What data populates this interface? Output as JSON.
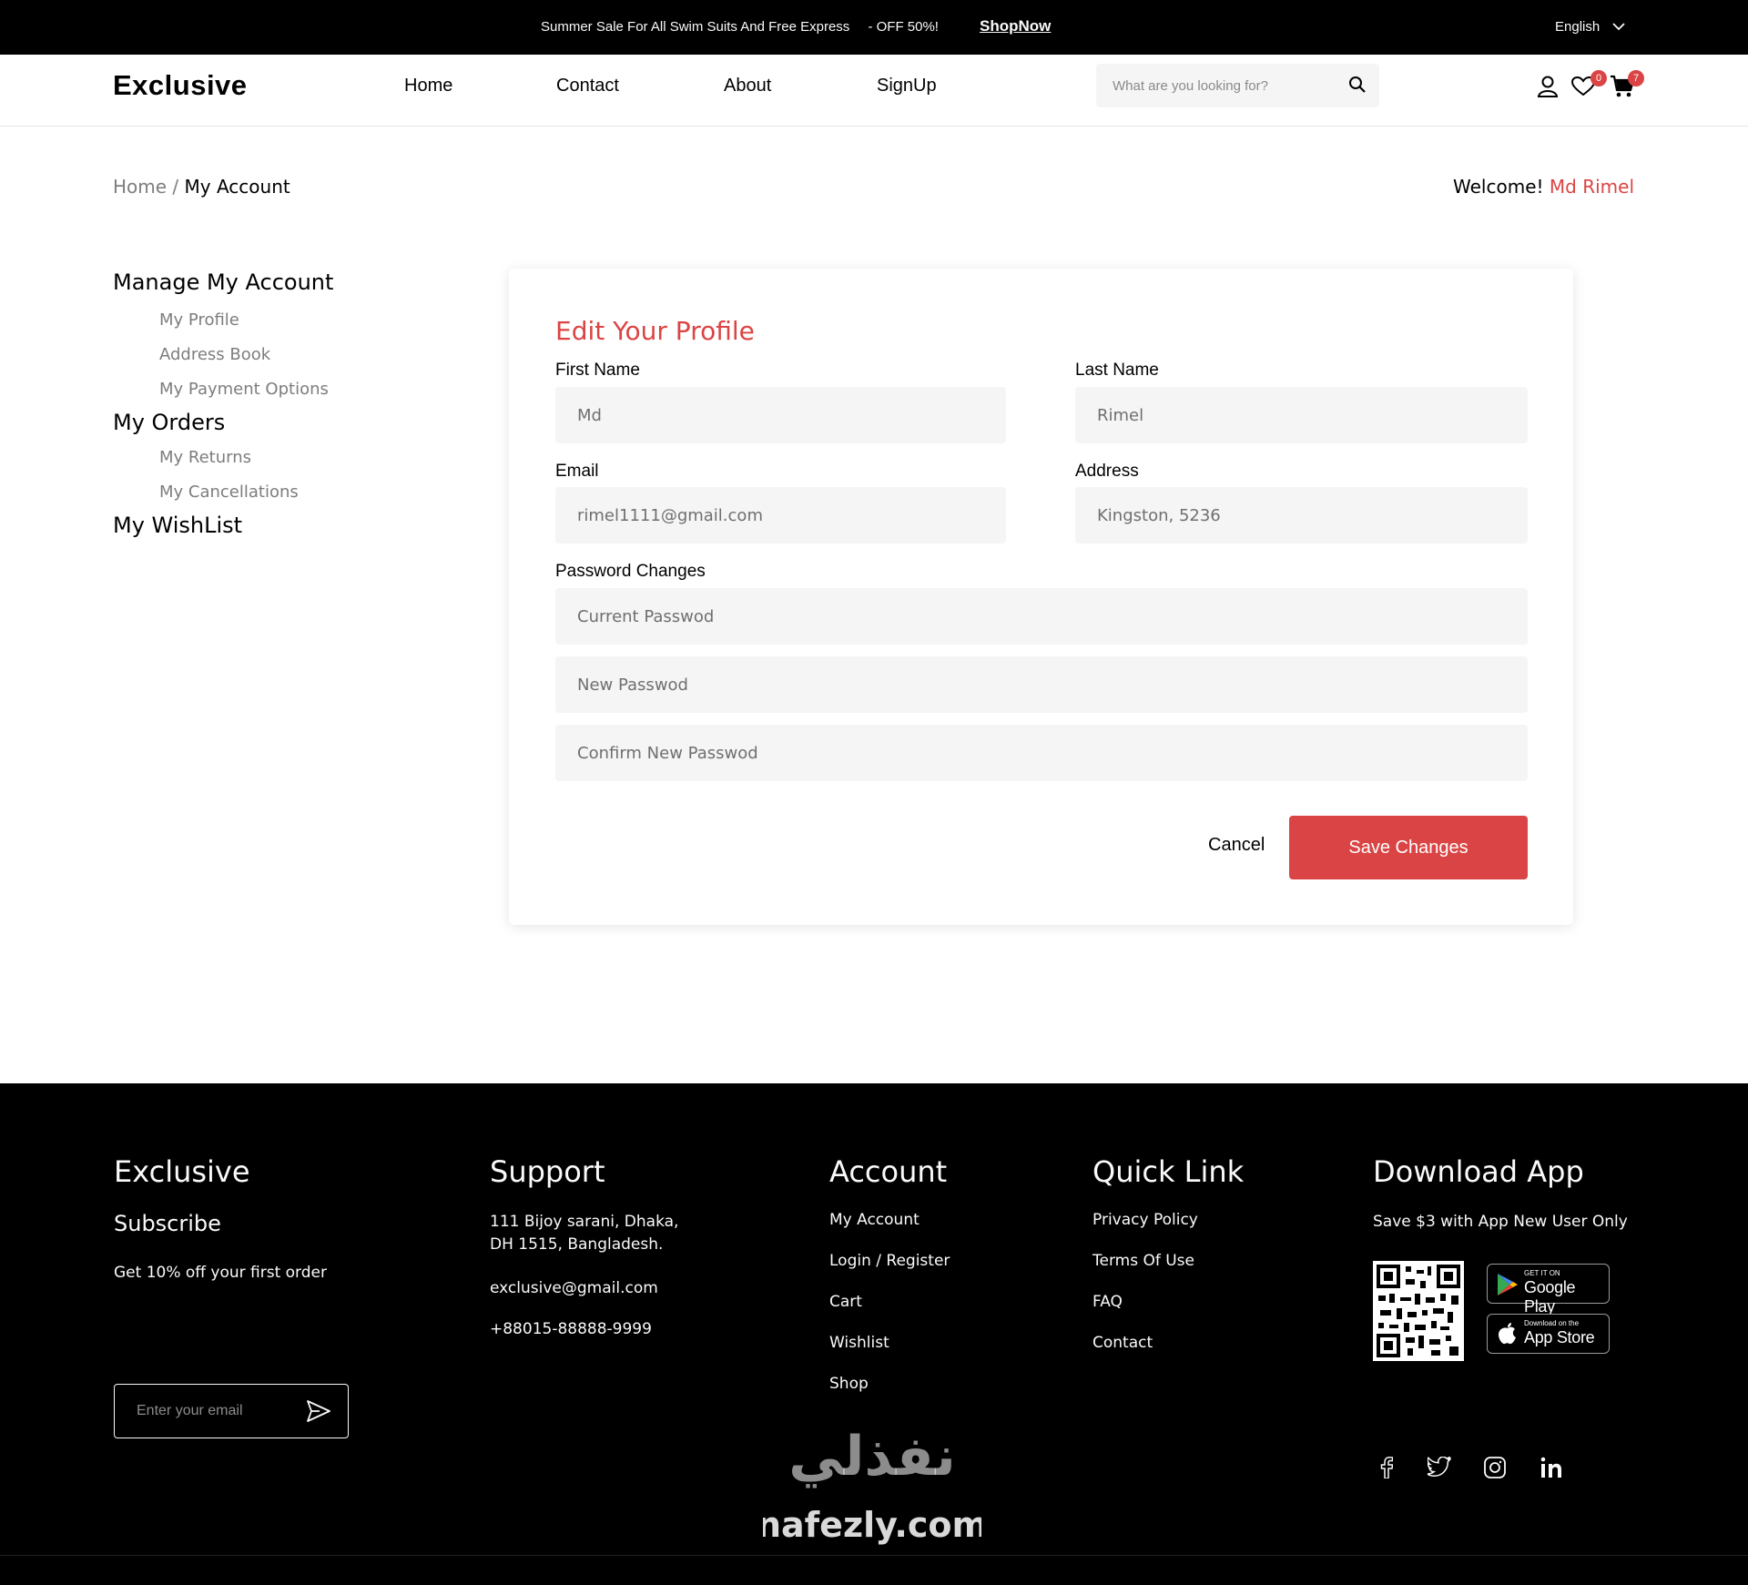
{
  "topbar": {
    "promo_text": "Summer Sale For All Swim Suits And Free Express",
    "discount_text": "- OFF 50%!",
    "shop_now": "ShopNow",
    "language": "English"
  },
  "header": {
    "logo": "Exclusive",
    "nav": [
      "Home",
      "Contact",
      "About",
      "SignUp"
    ],
    "search_placeholder": "What are you looking for?",
    "wishlist_count": "0",
    "cart_count": "7"
  },
  "breadcrumb": {
    "home": "Home",
    "separator": "/",
    "current": "My Account"
  },
  "welcome": {
    "prefix": "Welcome!",
    "name": "Md Rimel"
  },
  "sidebar": {
    "manage_account": "Manage My Account",
    "account_items": [
      "My Profile",
      "Address Book",
      "My Payment Options"
    ],
    "my_orders": "My Orders",
    "order_items": [
      "My Returns",
      "My Cancellations"
    ],
    "wishlist": "My WishList"
  },
  "profile_form": {
    "title": "Edit Your Profile",
    "first_name_label": "First Name",
    "first_name_placeholder": "Md",
    "last_name_label": "Last Name",
    "last_name_placeholder": "Rimel",
    "email_label": "Email",
    "email_placeholder": "rimel1111@gmail.com",
    "address_label": "Address",
    "address_placeholder": "Kingston, 5236",
    "password_label": "Password Changes",
    "current_password_placeholder": "Current Passwod",
    "new_password_placeholder": "New Passwod",
    "confirm_password_placeholder": "Confirm New Passwod",
    "cancel": "Cancel",
    "save": "Save Changes"
  },
  "footer": {
    "brand": {
      "title": "Exclusive",
      "subscribe": "Subscribe",
      "offer": "Get 10% off your first order",
      "email_placeholder": "Enter your email"
    },
    "support": {
      "title": "Support",
      "address_line1": "111 Bijoy sarani, Dhaka,",
      "address_line2": "DH 1515, Bangladesh.",
      "email": "exclusive@gmail.com",
      "phone": "+88015-88888-9999"
    },
    "account": {
      "title": "Account",
      "links": [
        "My Account",
        "Login / Register",
        "Cart",
        "Wishlist",
        "Shop"
      ]
    },
    "quick_link": {
      "title": "Quick Link",
      "links": [
        "Privacy Policy",
        "Terms Of Use",
        "FAQ",
        "Contact"
      ]
    },
    "download": {
      "title": "Download App",
      "subtitle": "Save $3 with App New User Only",
      "google_small": "GET IT ON",
      "google_big": "Google Play",
      "apple_small": "Download on the",
      "apple_big": "App Store"
    },
    "social_icons": [
      "facebook-icon",
      "twitter-icon",
      "instagram-icon",
      "linkedin-icon"
    ],
    "watermark": "nafezly.com"
  },
  "colors": {
    "accent": "#db4444",
    "topbar_bg": "#000000",
    "input_bg": "#f5f5f5"
  }
}
